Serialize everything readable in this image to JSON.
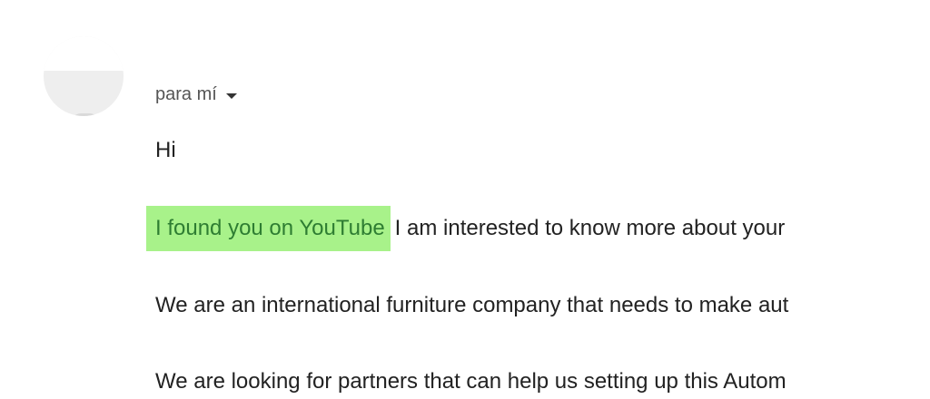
{
  "header": {
    "recipient_label": "para mí",
    "dropdown_icon": "chevron-down-icon"
  },
  "message": {
    "greeting": "Hi",
    "line1_highlight": "I found you on YouTube",
    "line1_rest": "I am interested to know more about your",
    "line2": "We are an international furniture company that needs to make aut",
    "line3": "We are looking for partners that can help us setting up this Autom"
  },
  "colors": {
    "highlight_bg": "#a8f28a",
    "highlight_text": "#2e7d32"
  }
}
